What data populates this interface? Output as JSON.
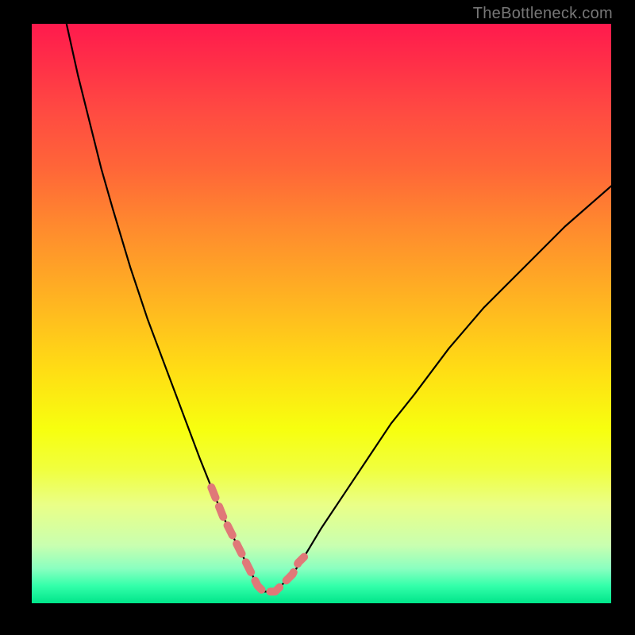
{
  "watermark": "TheBottleneck.com",
  "chart_data": {
    "type": "line",
    "title": "",
    "xlabel": "",
    "ylabel": "",
    "xlim": [
      0,
      100
    ],
    "ylim": [
      0,
      100
    ],
    "grid": false,
    "legend": false,
    "series": [
      {
        "name": "bottleneck-curve",
        "color": "#000000",
        "x": [
          6,
          8,
          10,
          12,
          14,
          17,
          20,
          23,
          26,
          29,
          31,
          33,
          35,
          37,
          38,
          39,
          40,
          41,
          42,
          43,
          45,
          47,
          50,
          54,
          58,
          62,
          66,
          72,
          78,
          85,
          92,
          100
        ],
        "y": [
          100,
          91,
          83,
          75,
          68,
          58,
          49,
          41,
          33,
          25,
          20,
          15,
          11,
          7,
          5,
          3,
          2,
          2,
          2,
          3,
          5,
          8,
          13,
          19,
          25,
          31,
          36,
          44,
          51,
          58,
          65,
          72
        ]
      },
      {
        "name": "optimal-highlight",
        "color": "#e07878",
        "style": "dashed-thick",
        "x": [
          31,
          33,
          35,
          37,
          38,
          39,
          40,
          41,
          42,
          43,
          45,
          46,
          47
        ],
        "y": [
          20,
          15,
          11,
          7,
          5,
          3,
          2,
          2,
          2,
          3,
          5,
          7,
          8
        ]
      }
    ]
  },
  "plot": {
    "bg_gradient_top": "#ff1a4d",
    "bg_gradient_bottom": "#00e58a",
    "frame_color": "#000000"
  }
}
